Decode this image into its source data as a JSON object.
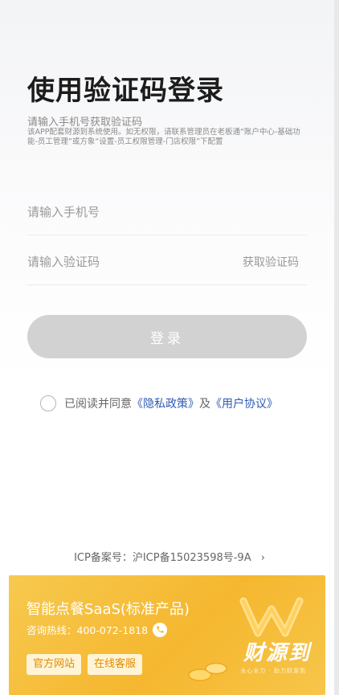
{
  "page": {
    "title": "使用验证码登录",
    "subtitle": "请输入手机号获取验证码",
    "notice": "该APP配套财源到系统使用。如无权限，请联系管理员在老板通“账户中心-基础功能-员工管理”或方象“设置-员工权限管理-门店权限”下配置"
  },
  "form": {
    "phone_placeholder": "请输入手机号",
    "code_placeholder": "请输入验证码",
    "get_code_label": "获取验证码",
    "login_label": "登录"
  },
  "agreement": {
    "prefix": "已阅读并同意",
    "privacy_label": "《隐私政策》",
    "and": "及",
    "terms_label": "《用户协议》"
  },
  "footer": {
    "icp_text": "ICP备案号：沪ICP备15023598号-9A",
    "chevron": "›"
  },
  "banner": {
    "title": "智能点餐SaaS(标准产品)",
    "hotline": "咨询热线：400-072-1818",
    "btn_website": "官方网站",
    "btn_service": "在线客服",
    "brand_name": "财源到",
    "brand_slogan": "全心全力 · 助力财源到"
  },
  "colors": {
    "accent_link": "#2f5bb3",
    "login_disabled": "#d2d2d2",
    "banner_gold": "#f5b72f"
  }
}
